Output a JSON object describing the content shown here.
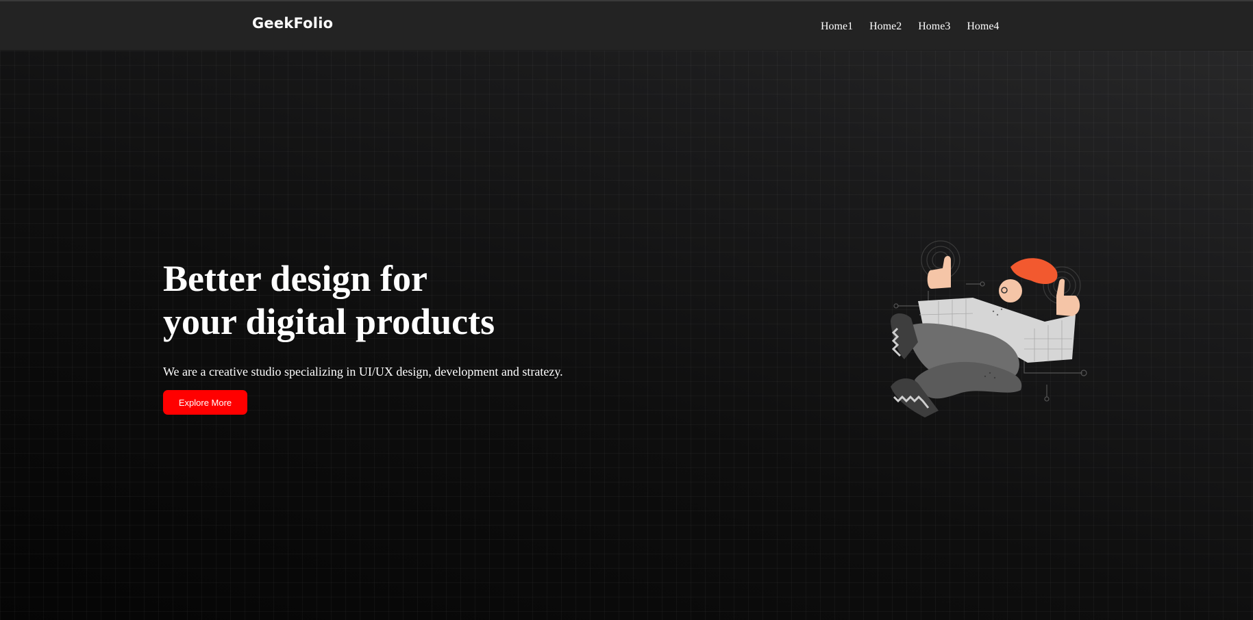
{
  "header": {
    "logo": "GeekFolio",
    "nav": [
      "Home1",
      "Home2",
      "Home3",
      "Home4"
    ]
  },
  "hero": {
    "title_line1": "Better design for",
    "title_line2": "your digital products",
    "subtitle": "We are a creative studio specializing in UI/UX design, development and stratezy.",
    "cta_label": "Explore More"
  },
  "colors": {
    "accent": "#ff0000",
    "header_bg": "#232323",
    "hair": "#f2592f",
    "skin": "#f5c5a7"
  },
  "illustration": {
    "icon": "person-touch-illustration"
  }
}
